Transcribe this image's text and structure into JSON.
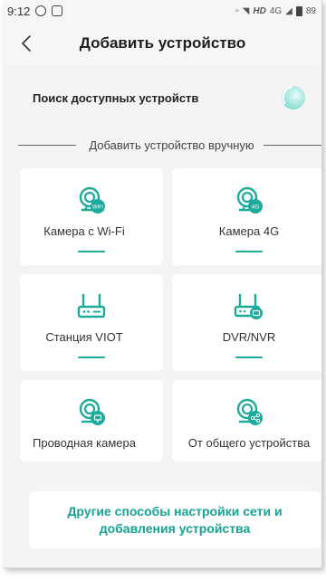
{
  "status_bar": {
    "time": "9:12",
    "right_text": "HD",
    "network": "4G",
    "battery": "89"
  },
  "header": {
    "title": "Добавить устройство"
  },
  "search": {
    "label": "Поиск доступных устройств"
  },
  "divider": {
    "label": "Добавить устройство вручную"
  },
  "devices": [
    {
      "label": "Камера с Wi-Fi",
      "icon": "wifi-camera-icon",
      "badge": "WiFi"
    },
    {
      "label": "Камера 4G",
      "icon": "4g-camera-icon",
      "badge": "4G"
    },
    {
      "label": "Станция VIOT",
      "icon": "station-router-icon"
    },
    {
      "label": "DVR/NVR",
      "icon": "dvr-nvr-icon"
    },
    {
      "label": "Проводная камера",
      "icon": "wired-camera-icon"
    },
    {
      "label": "От общего устройства",
      "icon": "shared-device-icon"
    }
  ],
  "more_options": {
    "label": "Другие способы настройки сети и добавления устройства"
  },
  "colors": {
    "accent": "#1cab9a",
    "link": "#16a393",
    "background": "#f4f4f4"
  }
}
